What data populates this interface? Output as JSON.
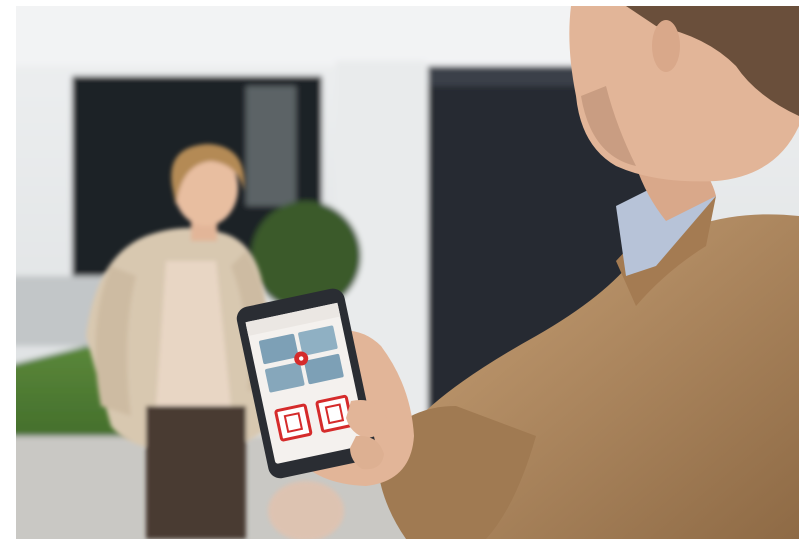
{
  "scene": {
    "description_free": true,
    "colors": {
      "wall": "#e4e6e7",
      "wall_shadow": "#cfd3d6",
      "dark_opening": "#1f2426",
      "garage_door": "#262c33",
      "lawn": "#4f7a33",
      "path": "#c9c8c4",
      "coat_woman": "#d8c8b0",
      "pants_woman": "#4a3a33",
      "hair_woman": "#b48a55",
      "jacket_man": "#b48c63",
      "shirt_man": "#b7c3d8",
      "skin": "#e2b598",
      "phone_body": "#2a2d33",
      "phone_screen": "#f4f1ee",
      "app_accent": "#d52b2b",
      "app_tile": "#7da0b6"
    },
    "phone_app": {
      "icons": [
        "camera-tile-icon",
        "camera-tile-icon",
        "camera-tile-icon",
        "camera-tile-icon",
        "alert-badge-icon",
        "door-button-icon",
        "door-button-icon"
      ]
    }
  }
}
